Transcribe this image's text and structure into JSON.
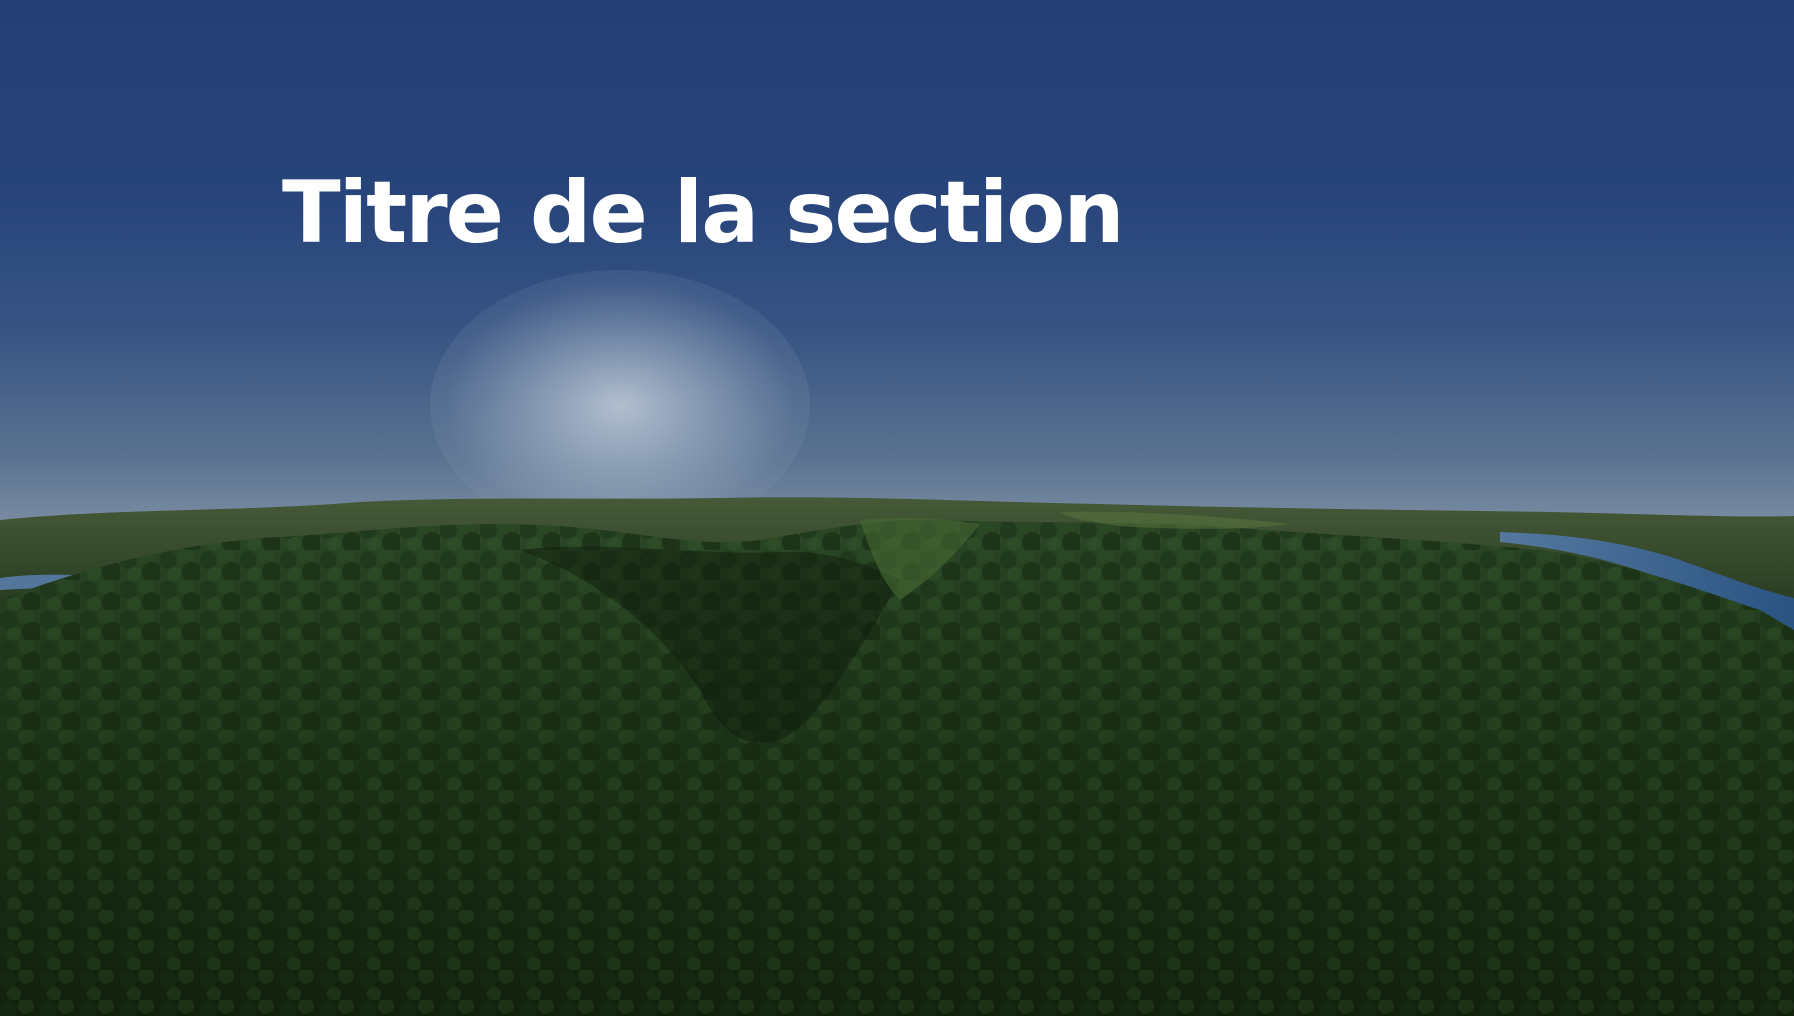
{
  "section": {
    "title": "Titre de la section"
  },
  "background": {
    "description_icon": "forest-landscape-image",
    "sky_color": "#2b4c88",
    "forest_color": "#1f3a1a",
    "water_color": "#3d6aa0"
  }
}
